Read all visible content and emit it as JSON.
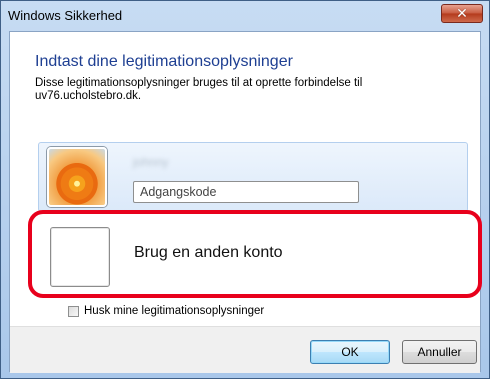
{
  "window": {
    "title": "Windows Sikkerhed",
    "close_glyph": "✕"
  },
  "dialog": {
    "heading": "Indtast dine legitimationsoplysninger",
    "description_line1": "Disse legitimationsoplysninger bruges til at oprette forbindelse til",
    "description_line2": "uv76.ucholstebro.dk."
  },
  "account": {
    "username": "johnny",
    "avatar_icon": "flower-user-tile",
    "password_placeholder": "Adgangskode",
    "password_value": ""
  },
  "other_account": {
    "label": "Brug en anden konto",
    "tile_icon": "blank-user-tile"
  },
  "remember": {
    "label": "Husk mine legitimationsoplysninger",
    "checked": false
  },
  "buttons": {
    "ok_label": "OK",
    "cancel_label": "Annuller"
  },
  "colors": {
    "heading": "#1e3f92",
    "highlight_outline": "#e8001c",
    "close_button": "#c75a3e"
  }
}
